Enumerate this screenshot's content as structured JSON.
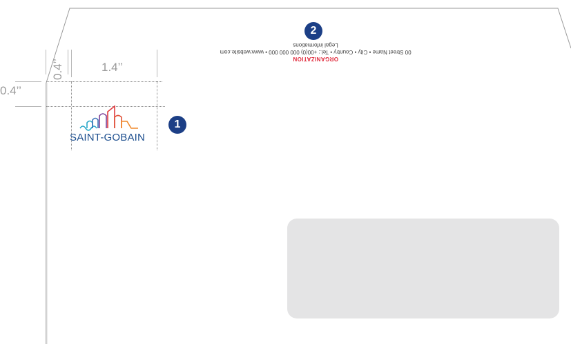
{
  "measurements": {
    "logo_width": "1.4’’",
    "top_margin": "0.4’’",
    "left_margin": "0.4’’"
  },
  "markers": {
    "logo": "1",
    "sender_address": "2"
  },
  "sender": {
    "organization": "ORGANIZATION",
    "address_line": "00 Street Name • City • Country • Tel.: +00(0) 000 000 000 • www.website.com",
    "legal": "Legal informations"
  },
  "logo": {
    "wordmark": "SAINT-GOBAIN",
    "colors": [
      "#1d4f8f",
      "#2aa8c9",
      "#e03a3e",
      "#f08a2c",
      "#7a3f98"
    ]
  },
  "colors": {
    "marker": "#1c3f86",
    "address_window": "#e4e4e5",
    "organization": "#e02a3c"
  }
}
